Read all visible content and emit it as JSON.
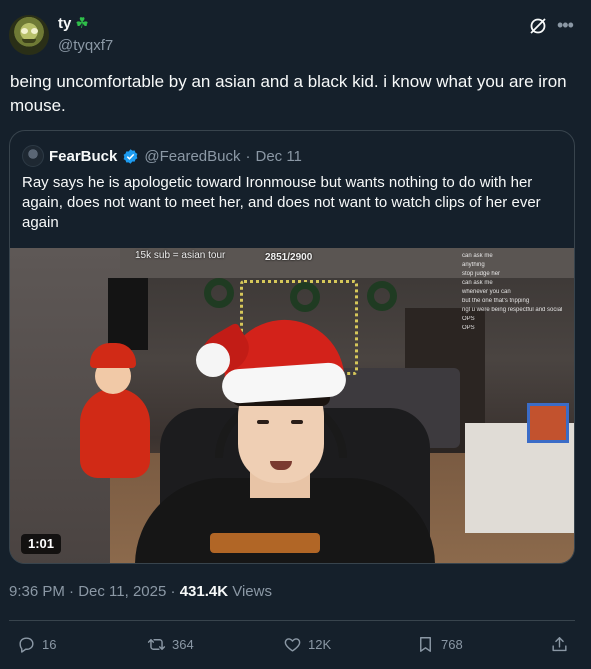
{
  "author": {
    "display_name": "ty",
    "emoji": "☘",
    "handle": "@tyqxf7"
  },
  "tweet_text": "being uncomfortable by an asian and a black kid. i know what you are iron mouse.",
  "quote": {
    "display_name": "FearBuck",
    "handle": "@FearedBuck",
    "separator": "·",
    "date": "Dec 11",
    "text": "Ray says he is apologetic toward Ironmouse but wants nothing to do with her again, does not want to meet her, and does not want to watch clips of her ever again",
    "video": {
      "duration": "1:01",
      "overlay_tour": "15k sub = asian tour",
      "overlay_count": "2851/2900",
      "chat_lines": [
        "can ask me",
        "anything",
        "stop judge her",
        "can ask me",
        "whenever you can",
        "but the one that's tripping",
        "ngl u were being respectful and social",
        "OPS",
        "OPS"
      ]
    }
  },
  "meta": {
    "time": "9:36 PM",
    "separator": "·",
    "date": "Dec 11, 2025",
    "separator2": "·",
    "views_count": "431.4K",
    "views_label": "Views"
  },
  "actions": {
    "replies": "16",
    "retweets": "364",
    "likes": "12K",
    "bookmarks": "768"
  },
  "colors": {
    "background": "#15202b",
    "text": "#f7f9f9",
    "secondary": "#8b98a5",
    "border": "#38444d",
    "verified": "#1d9bf0"
  }
}
